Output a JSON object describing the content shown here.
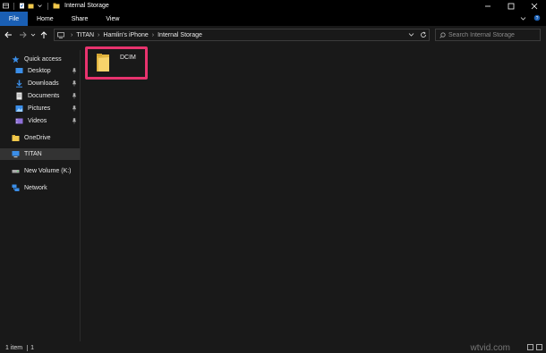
{
  "window": {
    "title": "Internal Storage",
    "controls": [
      "minimize",
      "maximize",
      "close"
    ]
  },
  "ribbon": {
    "tabs": [
      {
        "label": "File",
        "active": true
      },
      {
        "label": "Home"
      },
      {
        "label": "Share"
      },
      {
        "label": "View"
      }
    ]
  },
  "address": {
    "crumbs": [
      "TITAN",
      "Hamlin's iPhone",
      "Internal Storage"
    ],
    "separator": "›"
  },
  "search": {
    "placeholder": "Search Internal Storage"
  },
  "sidebar": {
    "items": [
      {
        "label": "Quick access",
        "icon": "star-icon"
      },
      {
        "label": "Desktop",
        "icon": "desktop-icon",
        "pinned": true
      },
      {
        "label": "Downloads",
        "icon": "download-icon",
        "pinned": true
      },
      {
        "label": "Documents",
        "icon": "document-icon",
        "pinned": true
      },
      {
        "label": "Pictures",
        "icon": "picture-icon",
        "pinned": true
      },
      {
        "label": "Videos",
        "icon": "video-icon",
        "pinned": true
      },
      {
        "label": "OneDrive",
        "icon": "onedrive-icon"
      },
      {
        "label": "TITAN",
        "icon": "computer-icon",
        "selected": true
      },
      {
        "label": "New Volume (K:)",
        "icon": "drive-icon"
      },
      {
        "label": "Network",
        "icon": "network-icon"
      }
    ]
  },
  "content": {
    "items": [
      {
        "name": "DCIM",
        "type": "folder",
        "highlighted": true
      }
    ]
  },
  "status": {
    "count": "1 item",
    "extra": "1"
  },
  "watermark": "wtvid.com",
  "colors": {
    "accent": "#1a5fb4",
    "highlight": "#e8336e",
    "folder": "#f2c94c"
  }
}
